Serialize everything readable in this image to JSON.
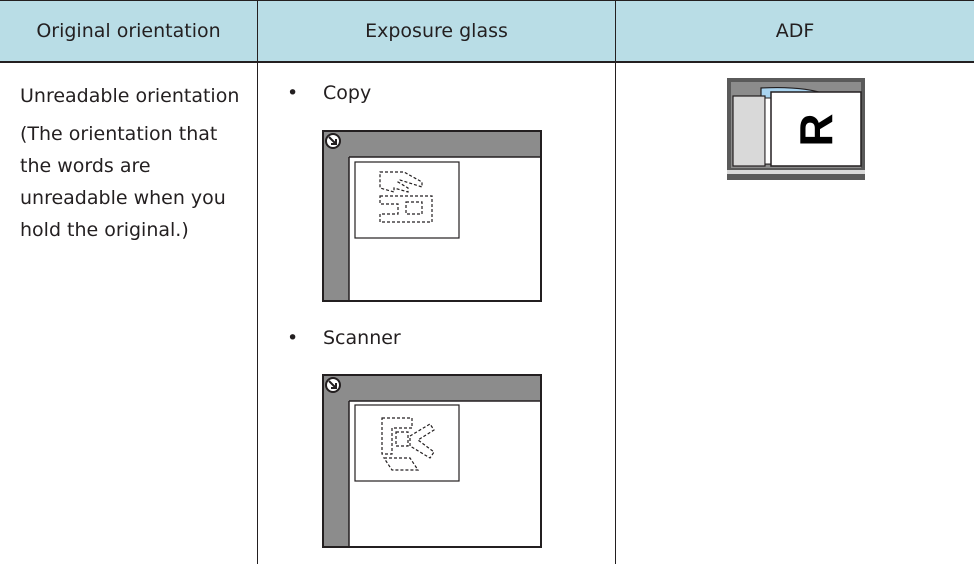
{
  "table": {
    "headers": [
      "Original orientation",
      "Exposure glass",
      "ADF"
    ],
    "row": {
      "orientation_title": "Unreadable orientation",
      "orientation_note": "(The orientation that the words are unreadable when you hold the original.)",
      "items": [
        {
          "bullet": "•",
          "label": "Copy"
        },
        {
          "bullet": "•",
          "label": "Scanner"
        }
      ],
      "adf_letter": "R"
    }
  },
  "colors": {
    "header_bg": "#b9dde6",
    "panel_gray": "#8c8c8c",
    "dark_gray": "#5a5a5a",
    "light_blue": "#a9d4f0",
    "light_gray": "#d9d9d9",
    "text": "#231f20"
  }
}
